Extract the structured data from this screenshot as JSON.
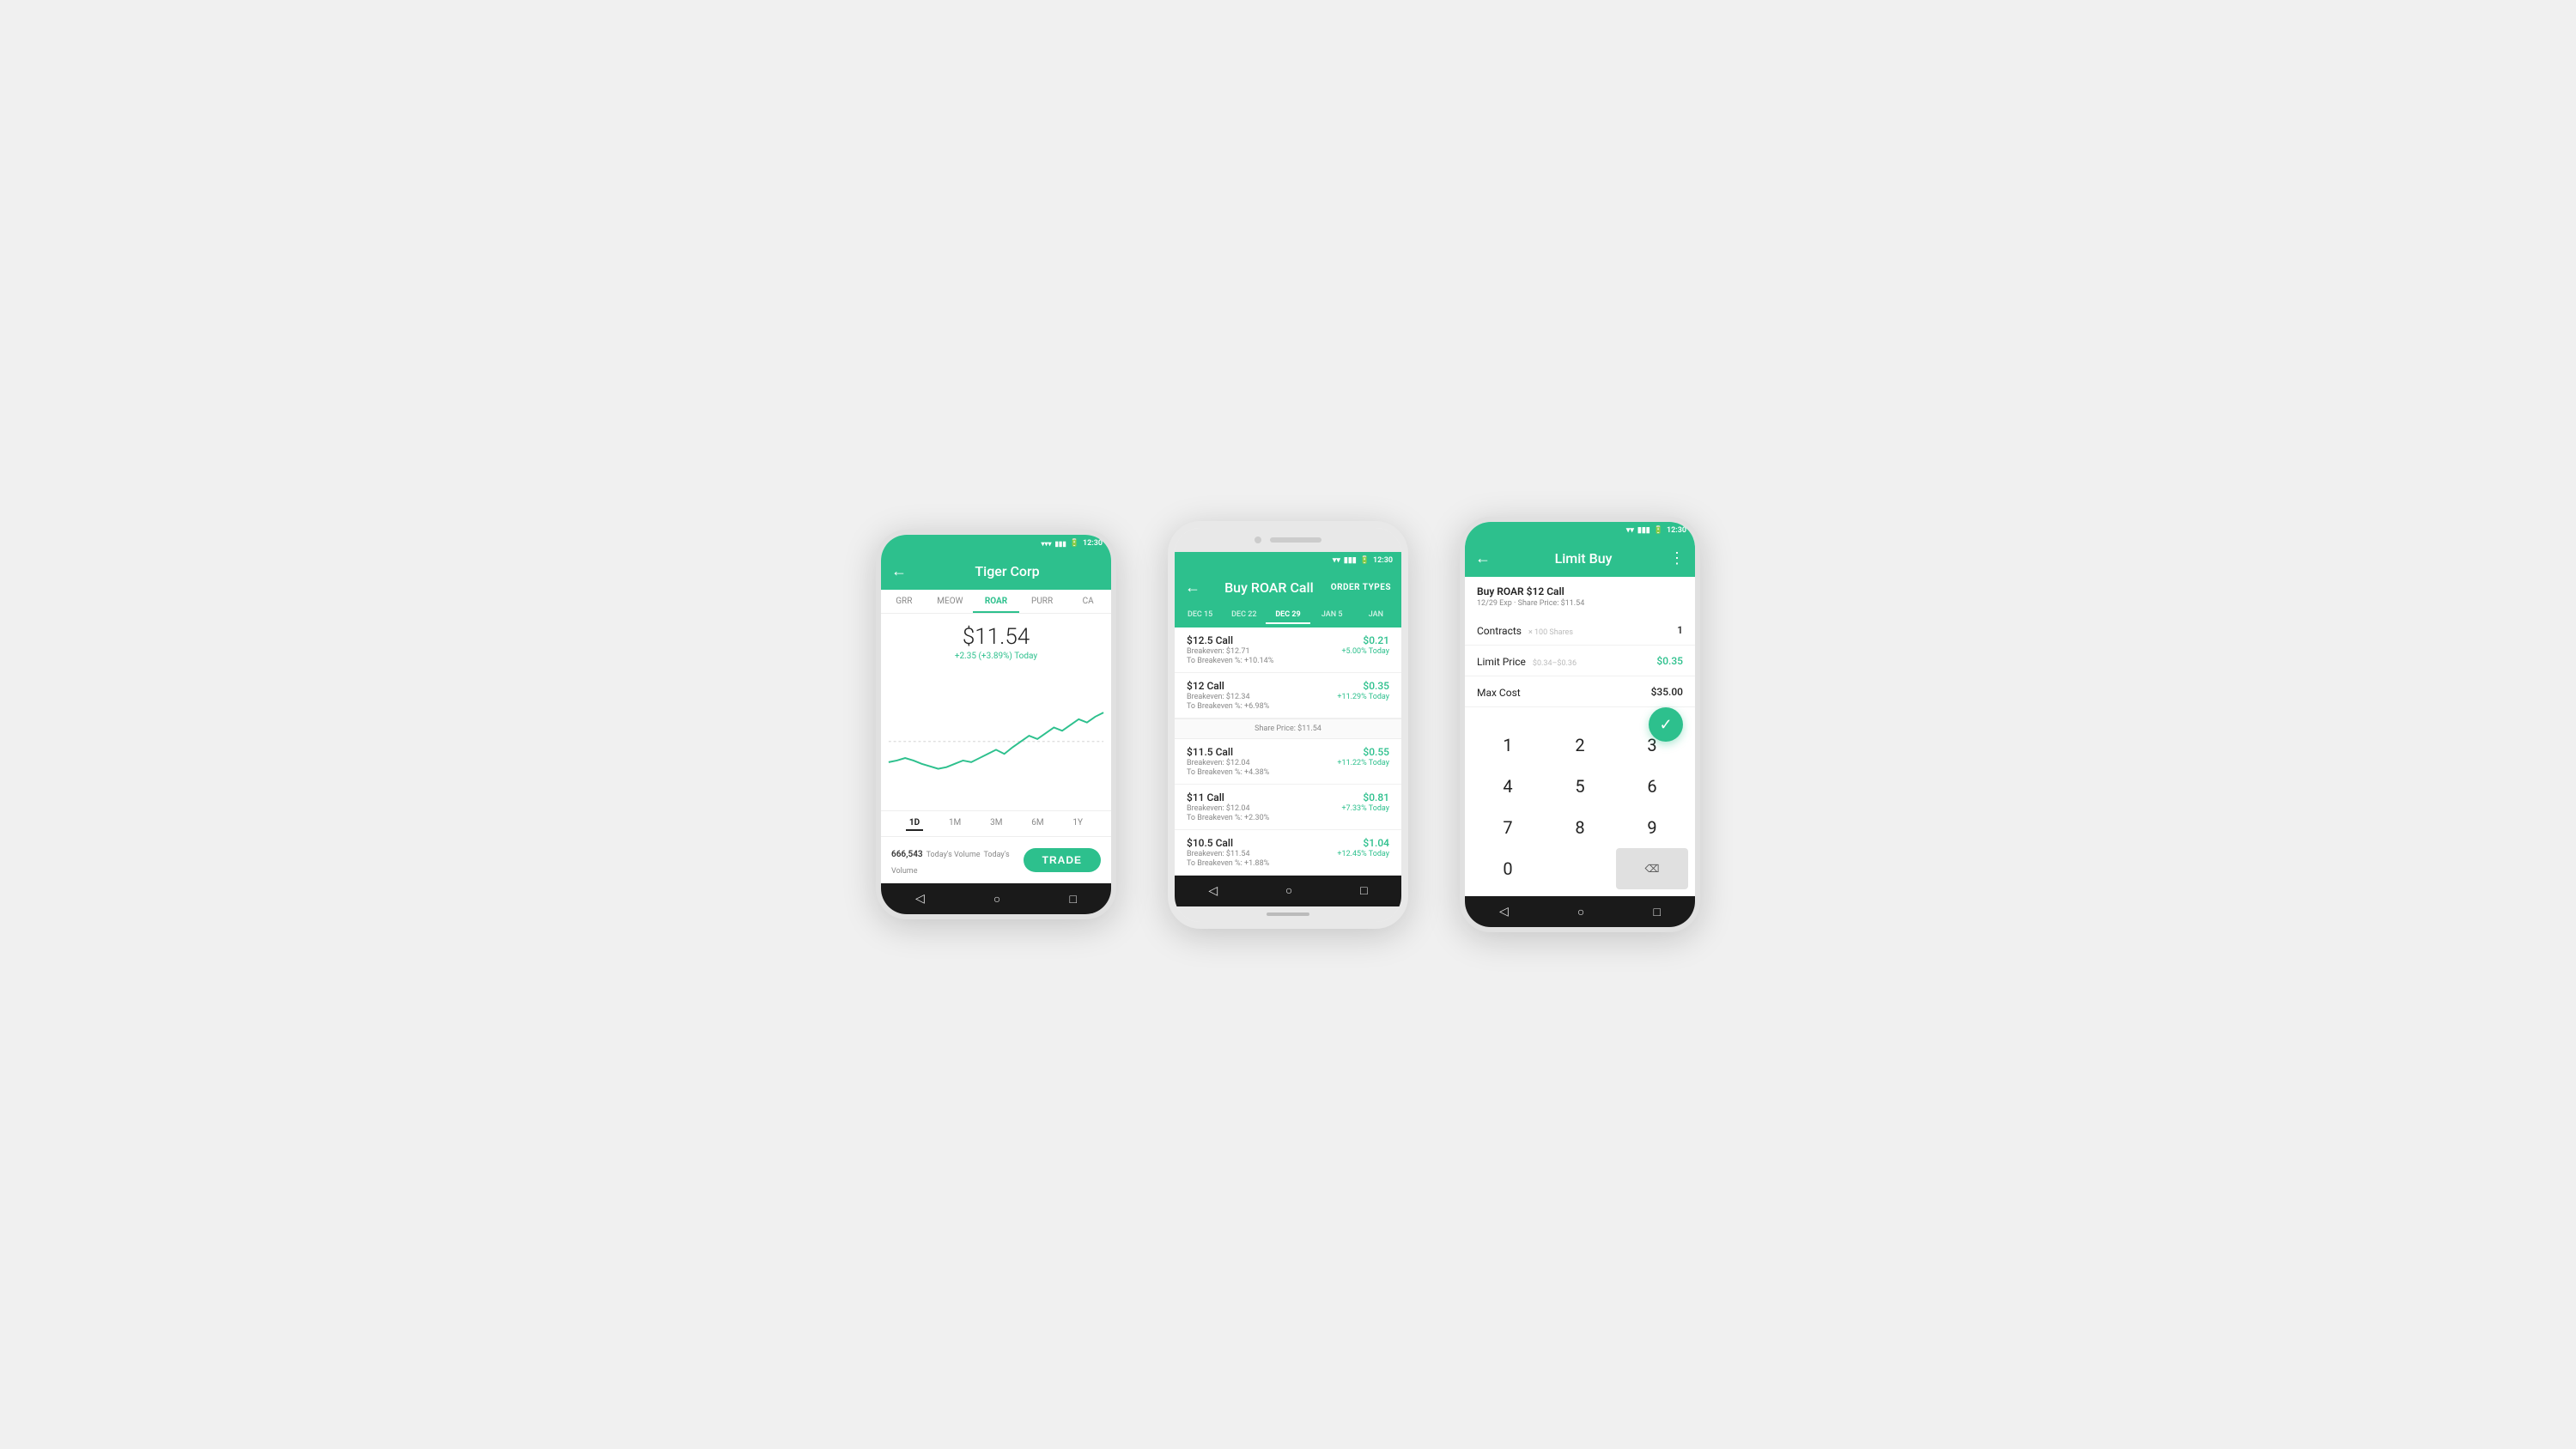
{
  "colors": {
    "primary": "#2dc08d",
    "dark": "#1a1a1a",
    "white": "#fff",
    "light_gray": "#f0f0f0",
    "text_primary": "#222",
    "text_secondary": "#888",
    "text_green": "#2dc08d"
  },
  "phone1": {
    "status_bar": {
      "time": "12:30"
    },
    "header": {
      "back": "←",
      "title": "Tiger Corp"
    },
    "tabs": [
      "GRR",
      "MEOW",
      "ROAR",
      "PURR",
      "CA"
    ],
    "active_tab": "ROAR",
    "price": "$11.54",
    "price_change": "+2.35 (+3.89%) Today",
    "time_periods": [
      "1D",
      "1M",
      "3M",
      "6M",
      "1Y"
    ],
    "active_period": "1D",
    "volume_number": "666,543",
    "volume_label": "Today's Volume",
    "trade_button": "TRADE"
  },
  "phone2": {
    "status_bar": {
      "time": "12:30"
    },
    "header": {
      "back": "←",
      "title": "Buy ROAR Call",
      "action": "ORDER TYPES"
    },
    "date_tabs": [
      "DEC 15",
      "DEC 22",
      "DEC 29",
      "JAN 5",
      "JAN"
    ],
    "active_date": "DEC 29",
    "options": [
      {
        "name": "$12.5 Call",
        "price": "$0.21",
        "detail1": "Breakeven: $12.71",
        "detail2": "To Breakeven %: +10.14%",
        "change": "+5.00% Today"
      },
      {
        "name": "$12 Call",
        "price": "$0.35",
        "detail1": "Breakeven: $12.34",
        "detail2": "To Breakeven %: +6.98%",
        "change": "+11.29% Today"
      }
    ],
    "share_price_divider": "Share Price: $11.54",
    "options_below": [
      {
        "name": "$11.5 Call",
        "price": "$0.55",
        "detail1": "Breakeven: $12.04",
        "detail2": "To Breakeven %: +4.38%",
        "change": "+11.22% Today"
      },
      {
        "name": "$11 Call",
        "price": "$0.81",
        "detail1": "Breakeven: $12.04",
        "detail2": "To Breakeven %: +2.30%",
        "change": "+7.33% Today"
      },
      {
        "name": "$10.5 Call",
        "price": "$1.04",
        "detail1": "Breakeven: $11.54",
        "detail2": "To Breakeven %: +1.88%",
        "change": "+12.45% Today"
      }
    ]
  },
  "phone3": {
    "status_bar": {
      "time": "12:30"
    },
    "header": {
      "back": "←",
      "title": "Limit Buy",
      "action": "⋮"
    },
    "order_title": "Buy ROAR $12 Call",
    "order_subtitle": "12/29 Exp · Share Price: $11.54",
    "fields": [
      {
        "label": "Contracts",
        "hint": "× 100 Shares",
        "value": "1"
      },
      {
        "label": "Limit Price",
        "hint": "$0.34–$0.36",
        "value": "$0.35",
        "green": true
      },
      {
        "label": "Max Cost",
        "hint": "",
        "value": "$35.00"
      }
    ],
    "numpad": [
      "1",
      "2",
      "3",
      "4",
      "5",
      "6",
      "7",
      "8",
      "9",
      "0",
      "⌫"
    ],
    "confirm_icon": "✓"
  }
}
